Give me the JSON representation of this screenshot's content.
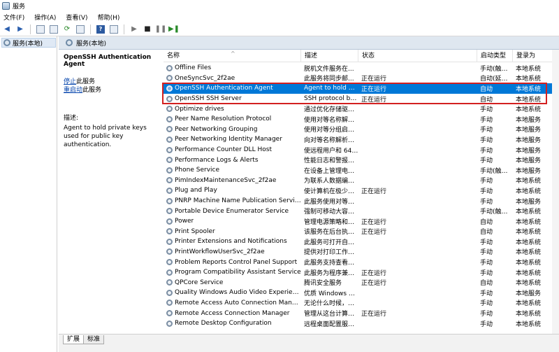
{
  "window": {
    "title": "服务"
  },
  "menu": [
    "文件(F)",
    "操作(A)",
    "查看(V)",
    "帮助(H)"
  ],
  "toolbar": {
    "back_icon": "arrow-left-icon",
    "forward_icon": "arrow-right-icon",
    "play_icon": "play-icon",
    "stop_icon": "stop-icon",
    "pause_icon": "pause-icon",
    "restart_icon": "restart-icon"
  },
  "tree": {
    "root_label": "服务(本地)"
  },
  "header": {
    "title": "服务(本地)"
  },
  "details": {
    "service_title": "OpenSSH Authentication Agent",
    "stop_link": "停止",
    "stop_suffix": "此服务",
    "restart_link": "重启动",
    "restart_suffix": "此服务",
    "desc_label": "描述:",
    "desc_text": "Agent to hold private keys used for public key authentication."
  },
  "columns": {
    "name": "名称",
    "description": "描述",
    "status": "状态",
    "startup": "启动类型",
    "logon": "登录为"
  },
  "services": [
    {
      "name": "Offline Files",
      "description": "脱机文件服务在...",
      "status": "",
      "startup": "手动(触发...",
      "logon": "本地系统"
    },
    {
      "name": "OneSyncSvc_2f2ae",
      "description": "此服务将同步邮...",
      "status": "正在运行",
      "startup": "自动(延迟...",
      "logon": "本地系统"
    },
    {
      "name": "OpenSSH Authentication Agent",
      "description": "Agent to hold pr...",
      "status": "正在运行",
      "startup": "自动",
      "logon": "本地系统",
      "selected": true
    },
    {
      "name": "OpenSSH SSH Server",
      "description": "SSH protocol ba...",
      "status": "正在运行",
      "startup": "自动",
      "logon": "本地系统"
    },
    {
      "name": "Optimize drives",
      "description": "通过优化存储驱动...",
      "status": "",
      "startup": "手动",
      "logon": "本地系统"
    },
    {
      "name": "Peer Name Resolution Protocol",
      "description": "使用对等名称解析...",
      "status": "",
      "startup": "手动",
      "logon": "本地服务"
    },
    {
      "name": "Peer Networking Grouping",
      "description": "使用对等分组启用...",
      "status": "",
      "startup": "手动",
      "logon": "本地服务"
    },
    {
      "name": "Peer Networking Identity Manager",
      "description": "向对等名称解析协...",
      "status": "",
      "startup": "手动",
      "logon": "本地服务"
    },
    {
      "name": "Performance Counter DLL Host",
      "description": "使远程用户和 64 ...",
      "status": "",
      "startup": "手动",
      "logon": "本地服务"
    },
    {
      "name": "Performance Logs & Alerts",
      "description": "性能日志和警报根...",
      "status": "",
      "startup": "手动",
      "logon": "本地服务"
    },
    {
      "name": "Phone Service",
      "description": "在设备上管理电话...",
      "status": "",
      "startup": "手动(触发...",
      "logon": "本地服务"
    },
    {
      "name": "PimIndexMaintenanceSvc_2f2ae",
      "description": "为联系人数据编制...",
      "status": "",
      "startup": "手动",
      "logon": "本地系统"
    },
    {
      "name": "Plug and Play",
      "description": "使计算机在极少或...",
      "status": "正在运行",
      "startup": "手动",
      "logon": "本地系统"
    },
    {
      "name": "PNRP Machine Name Publication Service",
      "description": "此服务使用对等名...",
      "status": "",
      "startup": "手动",
      "logon": "本地服务"
    },
    {
      "name": "Portable Device Enumerator Service",
      "description": "强制可移动大容量...",
      "status": "",
      "startup": "手动(触发...",
      "logon": "本地系统"
    },
    {
      "name": "Power",
      "description": "管理电源策略和电...",
      "status": "正在运行",
      "startup": "自动",
      "logon": "本地系统"
    },
    {
      "name": "Print Spooler",
      "description": "该服务在后台执行...",
      "status": "正在运行",
      "startup": "自动",
      "logon": "本地系统"
    },
    {
      "name": "Printer Extensions and Notifications",
      "description": "此服务可打开自定...",
      "status": "",
      "startup": "手动",
      "logon": "本地系统"
    },
    {
      "name": "PrintWorkflowUserSvc_2f2ae",
      "description": "提供对打印工作流...",
      "status": "",
      "startup": "手动",
      "logon": "本地系统"
    },
    {
      "name": "Problem Reports Control Panel Support",
      "description": "此服务支持查看、...",
      "status": "",
      "startup": "手动",
      "logon": "本地系统"
    },
    {
      "name": "Program Compatibility Assistant Service",
      "description": "此服务为程序兼容...",
      "status": "正在运行",
      "startup": "手动",
      "logon": "本地系统"
    },
    {
      "name": "QPCore Service",
      "description": "腾讯安全服务",
      "status": "正在运行",
      "startup": "自动",
      "logon": "本地系统"
    },
    {
      "name": "Quality Windows Audio Video Experience",
      "description": "优质 Windows 音...",
      "status": "",
      "startup": "手动",
      "logon": "本地服务"
    },
    {
      "name": "Remote Access Auto Connection Manager",
      "description": "无论什么时候，当...",
      "status": "",
      "startup": "手动",
      "logon": "本地系统"
    },
    {
      "name": "Remote Access Connection Manager",
      "description": "管理从这台计算机...",
      "status": "正在运行",
      "startup": "手动",
      "logon": "本地系统"
    },
    {
      "name": "Remote Desktop Configuration",
      "description": "远程桌面配置服务...",
      "status": "",
      "startup": "手动",
      "logon": "本地系统"
    }
  ],
  "tabs": [
    "扩展",
    "标准"
  ]
}
